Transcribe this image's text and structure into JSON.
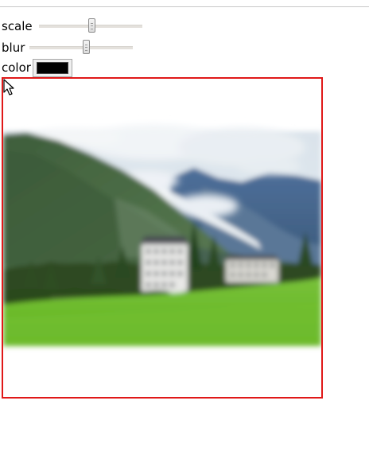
{
  "controls": {
    "scale": {
      "label": "scale",
      "value_fraction": 0.52
    },
    "blur": {
      "label": "blur",
      "value_fraction": 0.55
    },
    "color": {
      "label": "color",
      "value": "#000000"
    }
  },
  "colors": {
    "canvas_border": "#e01818",
    "top_rule": "#c8c8c8"
  },
  "canvas": {
    "content": "blurred landscape photo: mountains, clouds, trees, buildings, green meadow"
  },
  "icons": {
    "pointer": "mouse-pointer-icon"
  }
}
